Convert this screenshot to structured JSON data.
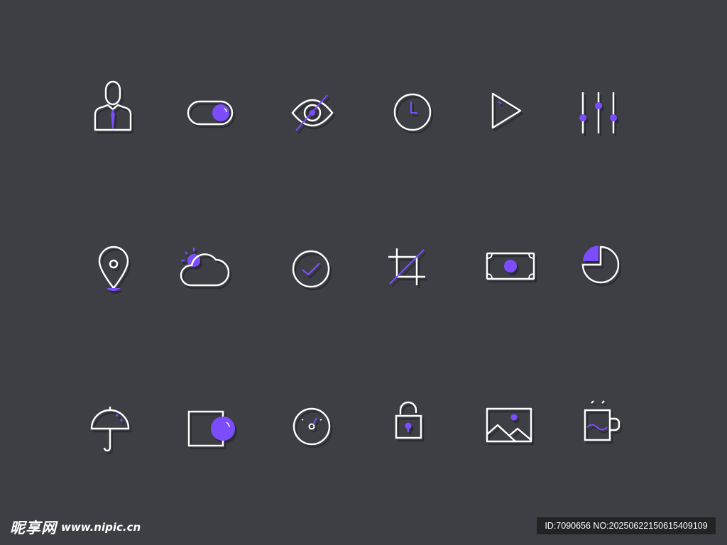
{
  "colors": {
    "background": "#3d3f44",
    "stroke": "#ffffff",
    "accent": "#7c4dff",
    "shadow": "#2e3034"
  },
  "icon_grid": {
    "rows": [
      [
        "businessman-icon",
        "toggle-switch-icon",
        "hidden-eye-icon",
        "clock-icon",
        "play-icon",
        "equalizer-sliders-icon"
      ],
      [
        "map-pin-icon",
        "sun-cloud-icon",
        "check-circle-icon",
        "crop-icon",
        "banknote-icon",
        "pie-chart-icon"
      ],
      [
        "umbrella-icon",
        "square-circle-icon",
        "speedometer-icon",
        "unlocked-padlock-icon",
        "landscape-image-icon",
        "hot-mug-icon"
      ]
    ]
  },
  "watermark": {
    "brand": "昵享网",
    "url": "www.nipic.cn",
    "id_text": "ID:7090656 NO:20250622150615409109"
  }
}
